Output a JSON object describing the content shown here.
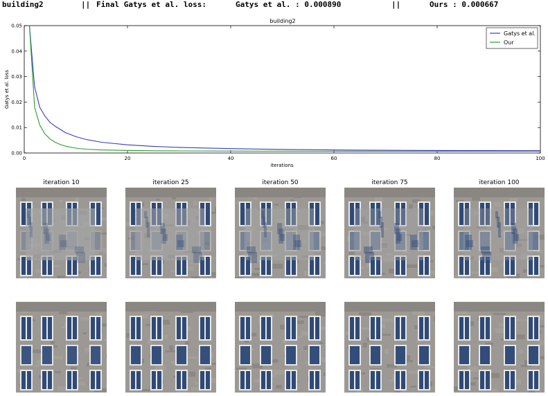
{
  "header": {
    "name": "building2",
    "sep1": "||",
    "final_label": "Final Gatys et al. loss:",
    "gatys_entry": "Gatys et al. : 0.000890",
    "sep2": "||",
    "ours_entry": "Ours : 0.000667"
  },
  "chart_data": {
    "type": "line",
    "title": "building2",
    "xlabel": "iterations",
    "ylabel": "Gatys et al. loss",
    "xlim": [
      0,
      100
    ],
    "ylim": [
      0,
      0.05
    ],
    "xticks": [
      "0",
      "20",
      "40",
      "60",
      "80",
      "100"
    ],
    "yticks": [
      "0.00",
      "0.01",
      "0.02",
      "0.03",
      "0.04",
      "0.05"
    ],
    "grid": false,
    "legend_position": "top-right",
    "series": [
      {
        "name": "Gatys et al.",
        "color": "#3a3ac0",
        "x": [
          1,
          2,
          3,
          4,
          5,
          6,
          7,
          8,
          10,
          12,
          15,
          20,
          25,
          30,
          40,
          50,
          60,
          70,
          80,
          90,
          100
        ],
        "y": [
          0.05,
          0.026,
          0.018,
          0.0145,
          0.012,
          0.0105,
          0.0092,
          0.008,
          0.0064,
          0.0053,
          0.0042,
          0.0032,
          0.0026,
          0.0022,
          0.0017,
          0.0014,
          0.0012,
          0.00107,
          0.00099,
          0.00093,
          0.00089
        ]
      },
      {
        "name": "Our",
        "color": "#2a9a2a",
        "x": [
          1,
          2,
          3,
          4,
          5,
          6,
          7,
          8,
          10,
          12,
          15,
          20,
          25,
          30,
          40,
          50,
          60,
          70,
          80,
          90,
          100
        ],
        "y": [
          0.05,
          0.018,
          0.011,
          0.0075,
          0.0055,
          0.0042,
          0.0033,
          0.0027,
          0.0019,
          0.0015,
          0.0012,
          0.001,
          0.00088,
          0.00082,
          0.00076,
          0.00073,
          0.00071,
          0.0007,
          0.00069,
          0.00068,
          0.000667
        ]
      }
    ]
  },
  "thumbnails": {
    "row1_captions": [
      "iteration 10",
      "iteration 25",
      "iteration 50",
      "iteration 75",
      "iteration 100"
    ],
    "row1_blur_level": [
      1.0,
      0.85,
      0.7,
      0.6,
      0.55
    ],
    "row2_blur_level": [
      0.1,
      0.05,
      0.03,
      0.02,
      0.02
    ]
  },
  "colors": {
    "facade": "#9c9893",
    "facade_dark": "#6f6b66",
    "window": "#2f4a78",
    "frame": "#e9e9e6"
  }
}
